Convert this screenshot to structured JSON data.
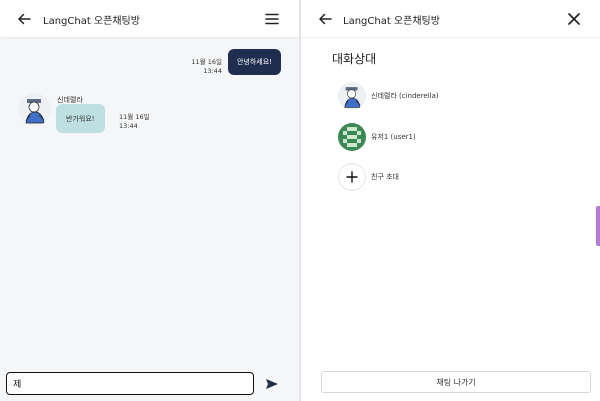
{
  "chat": {
    "title": "LangChat 오픈채팅방",
    "messages": {
      "mine": {
        "text": "안녕하세요!",
        "date": "11월 16일",
        "time": "13:44"
      },
      "other": {
        "sender": "신데렐라",
        "text": "반가워요!",
        "date": "11월 16일",
        "time": "13:44"
      }
    },
    "composer": {
      "value": "제",
      "placeholder": ""
    }
  },
  "panel": {
    "title": "LangChat 오픈채팅방",
    "section_title": "대화상대",
    "members": [
      {
        "name": "신데렐라 (cinderella)"
      },
      {
        "name": "유저1 (user1)"
      }
    ],
    "invite_label": "친구 초대",
    "leave_label": "채팅 나가기"
  },
  "colors": {
    "my_bubble": "#1f2d4f",
    "other_bubble": "#bfe0e2",
    "user_avatar": "#3b8a54",
    "accent_scroll": "#b37bd8"
  },
  "icons": [
    "arrow-left-icon",
    "hamburger-menu-icon",
    "send-icon",
    "close-icon",
    "plus-icon"
  ]
}
